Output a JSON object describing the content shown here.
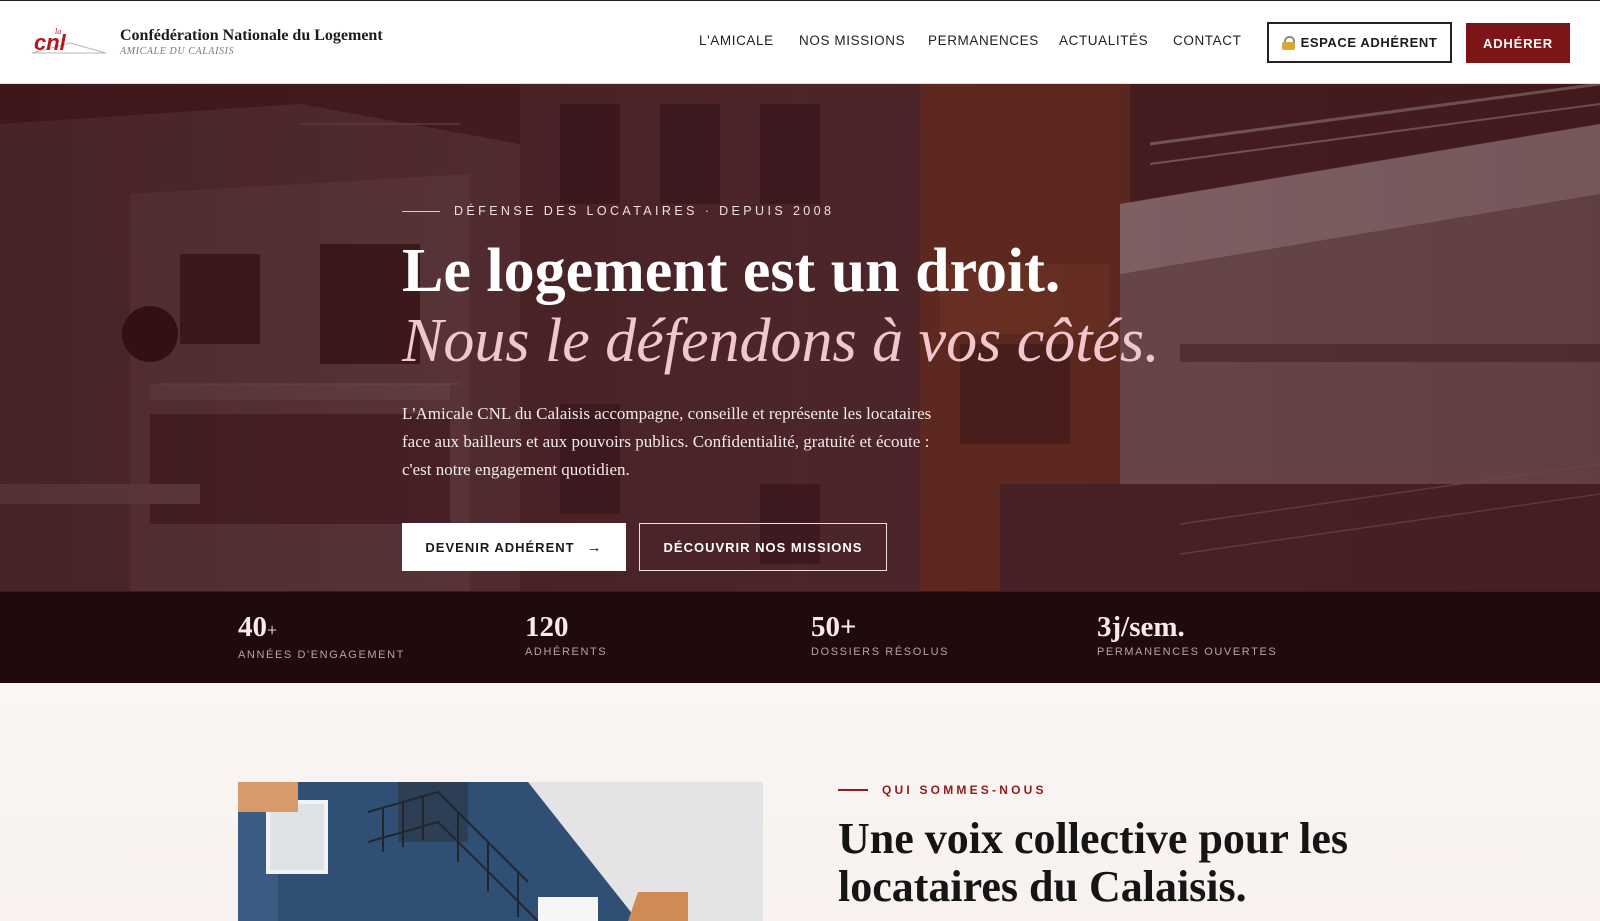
{
  "header": {
    "brand_title": "Confédération Nationale du Logement",
    "brand_subtitle": "AMICALE DU CALAISIS",
    "logo_text": "cnl",
    "logo_small": "la",
    "nav": [
      "L'AMICALE",
      "NOS MISSIONS",
      "PERMANENCES",
      "ACTUALITÉS",
      "CONTACT"
    ],
    "espace_label": "ESPACE ADHÉRENT",
    "adherer_label": "ADHÉRER"
  },
  "hero": {
    "eyebrow": "DÉFENSE DES LOCATAIRES · DEPUIS 2008",
    "title_line1": "Le logement est un droit.",
    "title_line2": "Nous le défendons à vos côtés.",
    "description": "L'Amicale CNL du Calaisis accompagne, conseille et représente les locataires face aux bailleurs et aux pouvoirs publics. Confidentialité, gratuité et écoute : c'est notre engagement quotidien.",
    "cta_primary": "DEVENIR ADHÉRENT",
    "cta_primary_arrow": "→",
    "cta_secondary": "DÉCOUVRIR NOS MISSIONS"
  },
  "stats": [
    {
      "value": "40",
      "suffix": "+",
      "label": "ANNÉES D'ENGAGEMENT"
    },
    {
      "value": "120",
      "suffix": "",
      "label": "ADHÉRENTS"
    },
    {
      "value": "50+",
      "suffix": "",
      "label": "DOSSIERS RÉSOLUS"
    },
    {
      "value": "3j/sem.",
      "suffix": "",
      "label": "PERMANENCES OUVERTES"
    }
  ],
  "about": {
    "eyebrow": "QUI SOMMES-NOUS",
    "title": "Une voix collective pour les locataires du Calaisis."
  },
  "colors": {
    "brand_red": "#7d1518",
    "hero_accent_pink": "#f2c6cd",
    "stats_bg": "#1f0a0e"
  }
}
